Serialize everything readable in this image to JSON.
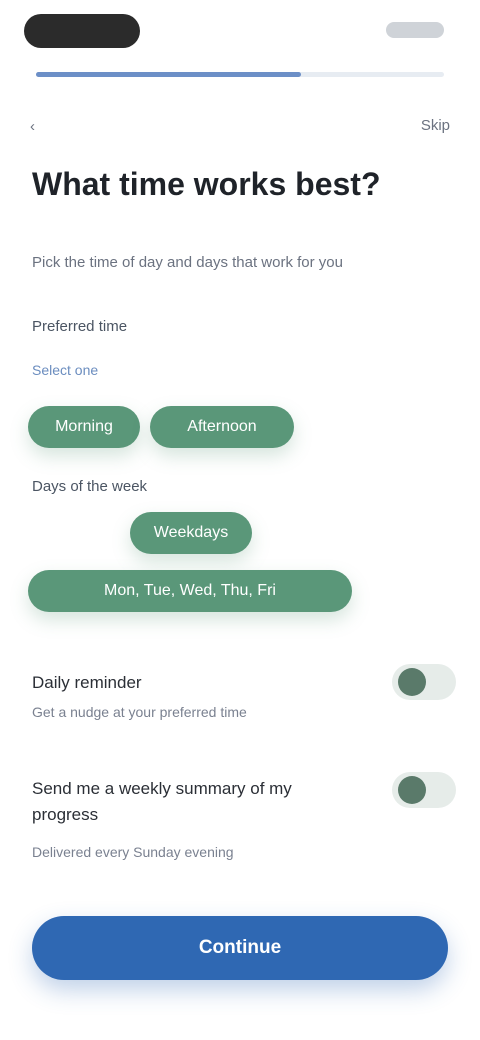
{
  "status_bar": {
    "time": "",
    "indicators": ""
  },
  "progress": {
    "fraction": 0.65
  },
  "nav": {
    "back_label": "‹",
    "skip_label": "Skip"
  },
  "header": {
    "title": "What time works best?",
    "subtitle": "Pick the time of day and days that work for you"
  },
  "preferences": {
    "time_label": "Preferred time",
    "time_hint": "Select one",
    "time_options": [
      {
        "label": "Morning"
      },
      {
        "label": "Afternoon"
      }
    ],
    "days_label": "Days of the week",
    "days_selected": "Weekdays",
    "days_summary": "Mon, Tue, Wed, Thu, Fri"
  },
  "toggles": [
    {
      "title": "Daily reminder",
      "description": "Get a nudge at your preferred time",
      "on": true
    },
    {
      "title": "Send me a weekly summary of my progress",
      "description": "Delivered every Sunday evening",
      "on": true
    }
  ],
  "footer": {
    "save_label": "Continue"
  },
  "colors": {
    "accent_green": "#5a9779",
    "primary_blue": "#2f68b3",
    "progress_blue": "#6c8fc7"
  }
}
